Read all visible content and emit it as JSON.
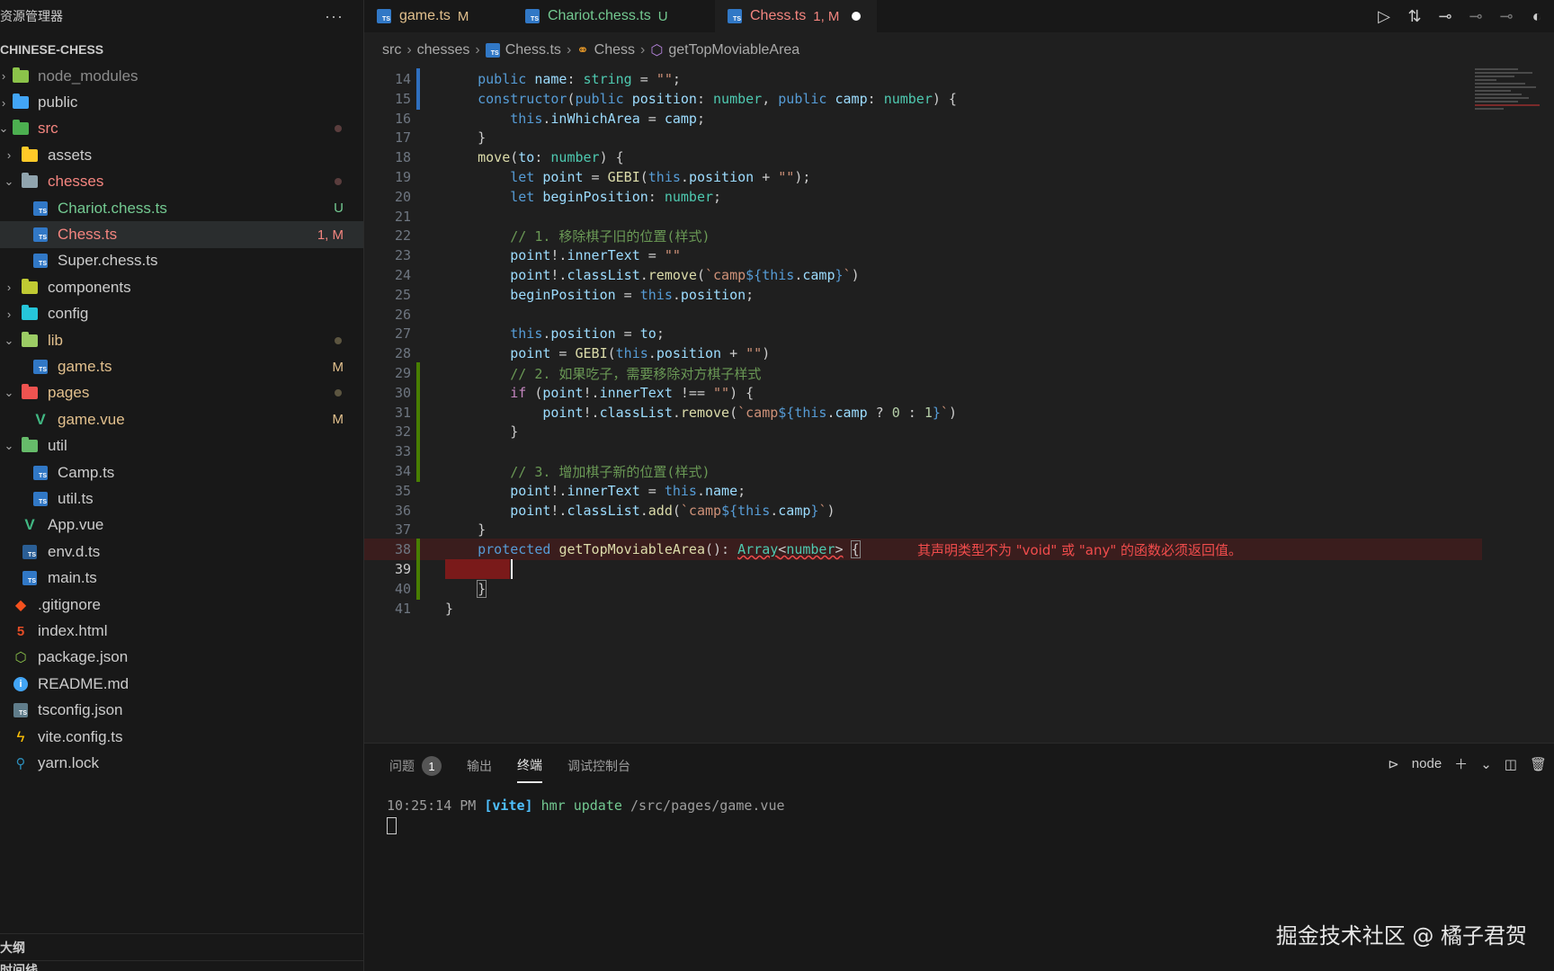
{
  "sidebar": {
    "title": "资源管理器",
    "more": "···",
    "project": "CHINESE-CHESS",
    "outline": "大纲",
    "timeline": "时间线",
    "items": [
      {
        "label": "node_modules",
        "badge": ""
      },
      {
        "label": "public",
        "badge": ""
      },
      {
        "label": "src",
        "badge": ""
      },
      {
        "label": "assets",
        "badge": ""
      },
      {
        "label": "chesses",
        "badge": ""
      },
      {
        "label": "Chariot.chess.ts",
        "badge": "U"
      },
      {
        "label": "Chess.ts",
        "badge": "1, M"
      },
      {
        "label": "Super.chess.ts",
        "badge": ""
      },
      {
        "label": "components",
        "badge": ""
      },
      {
        "label": "config",
        "badge": ""
      },
      {
        "label": "lib",
        "badge": ""
      },
      {
        "label": "game.ts",
        "badge": "M"
      },
      {
        "label": "pages",
        "badge": ""
      },
      {
        "label": "game.vue",
        "badge": "M"
      },
      {
        "label": "util",
        "badge": ""
      },
      {
        "label": "Camp.ts",
        "badge": ""
      },
      {
        "label": "util.ts",
        "badge": ""
      },
      {
        "label": "App.vue",
        "badge": ""
      },
      {
        "label": "env.d.ts",
        "badge": ""
      },
      {
        "label": "main.ts",
        "badge": ""
      },
      {
        "label": ".gitignore",
        "badge": ""
      },
      {
        "label": "index.html",
        "badge": ""
      },
      {
        "label": "package.json",
        "badge": ""
      },
      {
        "label": "README.md",
        "badge": ""
      },
      {
        "label": "tsconfig.json",
        "badge": ""
      },
      {
        "label": "vite.config.ts",
        "badge": ""
      },
      {
        "label": "yarn.lock",
        "badge": ""
      }
    ]
  },
  "tabs": [
    {
      "label": "game.ts",
      "tag": "M"
    },
    {
      "label": "Chariot.chess.ts",
      "tag": "U"
    },
    {
      "label": "Chess.ts",
      "tag": "1, M"
    }
  ],
  "breadcrumb": [
    "src",
    "chesses",
    "Chess.ts",
    "Chess",
    "getTopMoviableArea"
  ],
  "editor": {
    "line_numbers": [
      "14",
      "15",
      "16",
      "17",
      "18",
      "19",
      "20",
      "21",
      "22",
      "23",
      "24",
      "25",
      "26",
      "27",
      "28",
      "29",
      "30",
      "31",
      "32",
      "33",
      "34",
      "35",
      "36",
      "37",
      "38",
      "39",
      "40",
      "41"
    ],
    "error_message": "其声明类型不为 \"void\" 或 \"any\" 的函数必须返回值。"
  },
  "panel": {
    "tabs": [
      {
        "label": "问题",
        "count": "1"
      },
      {
        "label": "输出"
      },
      {
        "label": "终端"
      },
      {
        "label": "调试控制台"
      }
    ],
    "terminal_name": "node",
    "terminal_line": {
      "time": "10:25:14 PM",
      "source": "[vite]",
      "event": "hmr update",
      "path": "/src/pages/game.vue"
    }
  },
  "watermark": "掘金技术社区 @ 橘子君贺",
  "colors": {
    "accent_red": "#f4857f",
    "accent_orange": "#e2c08d",
    "accent_green": "#73c991",
    "error": "#f14c4c"
  }
}
